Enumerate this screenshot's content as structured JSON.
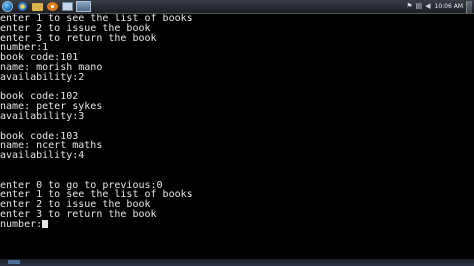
{
  "taskbar": {
    "start": "start-orb",
    "pinned": [
      "ie-icon",
      "folder-icon",
      "media-icon",
      "app-icon"
    ],
    "tray_icons": [
      "volume-icon",
      "network-icon",
      "flag-icon"
    ],
    "clock": "10:06 AM"
  },
  "console": {
    "lines": [
      "enter 1 to see the list of books",
      "enter 2 to issue the book",
      "enter 3 to return the book",
      "number:1",
      "book code:101",
      "name: morish mano",
      "availability:2",
      "",
      "book code:102",
      "name: peter sykes",
      "availability:3",
      "",
      "book code:103",
      "name: ncert maths",
      "availability:4",
      "",
      "",
      "enter 0 to go to previous:0",
      "enter 1 to see the list of books",
      "enter 2 to issue the book",
      "enter 3 to return the book",
      "number:"
    ]
  }
}
